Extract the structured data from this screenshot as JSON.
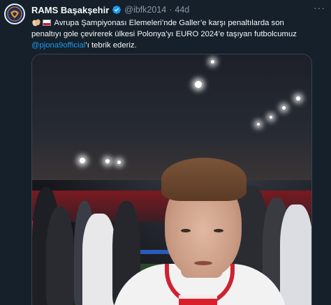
{
  "tweet": {
    "author_name": "RAMS Başakşehir",
    "handle": "@ibfk2014",
    "separator": "·",
    "time": "44d",
    "more_icon": "···",
    "text_line1": "Avrupa Şampiyonası Elemeleri’nde Galler’e karşı penaltılarda son",
    "text_line2": "penaltıyı gole çevirerek ülkesi Polonya’yı EURO 2024’e taşıyan futbolcumuz",
    "mention": "@pjona9official",
    "text_line3_rest": "’ı tebrik ederiz."
  },
  "icons": {
    "avatar": "rams-basaksehir-logo",
    "verified": "verified-badge-icon",
    "clap": "clapping-hands-emoji",
    "flag": "poland-flag-emoji",
    "more": "more-options-icon"
  },
  "colors": {
    "background": "#15202b",
    "text": "#f7f9f9",
    "muted": "#8b98a5",
    "link": "#1d9bf0",
    "verified": "#1d9bf0"
  },
  "media": {
    "type": "video",
    "description_icon": "video-thumbnail"
  }
}
